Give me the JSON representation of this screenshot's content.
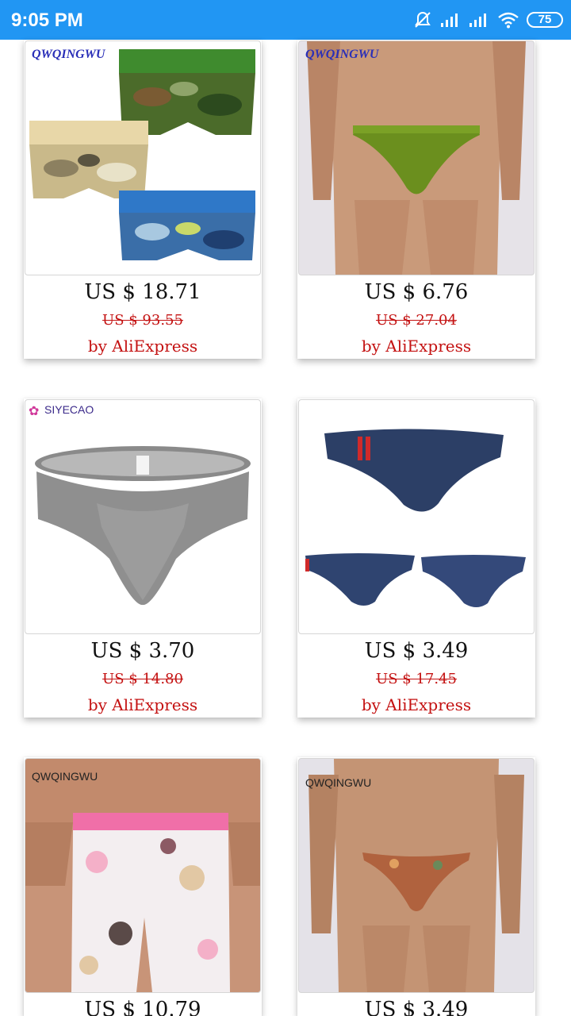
{
  "status_bar": {
    "time": "9:05 PM",
    "battery": "75",
    "icons": [
      "mute-icon",
      "signal-icon",
      "signal-icon",
      "wifi-icon",
      "battery-icon"
    ]
  },
  "products": [
    {
      "price": "US $ 18.71",
      "old_price": "US $ 93.55",
      "seller": "by AliExpress",
      "brand": "QWQINGWU",
      "image": "camo-boxer-briefs"
    },
    {
      "price": "US $ 6.76",
      "old_price": "US $ 27.04",
      "seller": "by AliExpress",
      "brand": "QWQINGWU",
      "image": "green-thong-model"
    },
    {
      "price": "US $ 3.70",
      "old_price": "US $ 14.80",
      "seller": "by AliExpress",
      "brand": "SIYECAO",
      "image": "gray-briefs"
    },
    {
      "price": "US $ 3.49",
      "old_price": "US $ 17.45",
      "seller": "by AliExpress",
      "brand": "",
      "image": "navy-briefs-set"
    },
    {
      "price": "US $ 10.79",
      "old_price": "",
      "seller": "",
      "brand": "QWQINGWU",
      "image": "floral-long-boxers"
    },
    {
      "price": "US $ 3.49",
      "old_price": "",
      "seller": "",
      "brand": "QWQINGWU",
      "image": "floral-thong-model"
    }
  ],
  "colors": {
    "status_bar": "#2196f3",
    "price_red": "#c41212"
  }
}
